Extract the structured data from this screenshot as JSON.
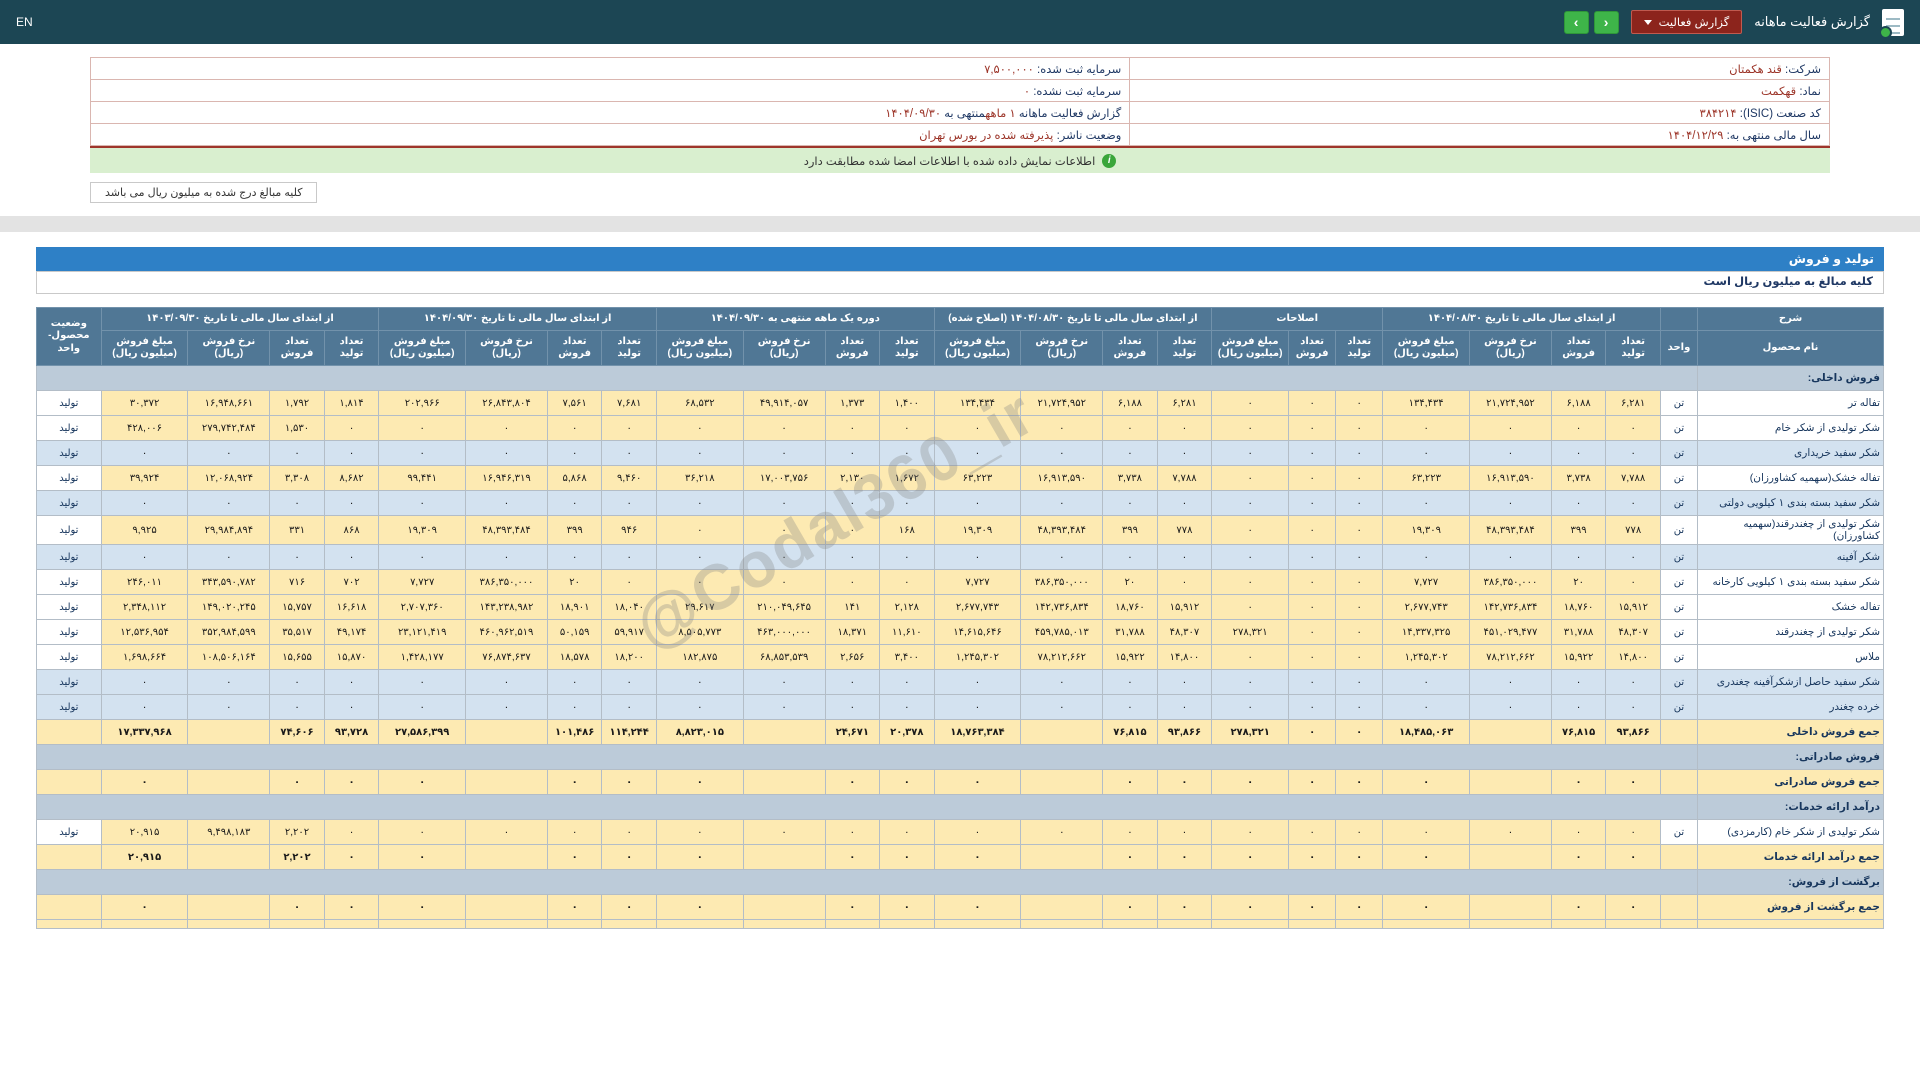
{
  "colors": {
    "topbar_bg": "#1c4654",
    "accent_red": "#8c241c",
    "accent_green": "#3eb449",
    "banner_blue": "#2e80c6",
    "table_header_blue": "#507795",
    "cell_yellow": "#fdeab2",
    "cell_blue": "#d3e2f0",
    "section_gray": "#bccbd9",
    "value_maroon": "#9c3428",
    "label_navy": "#1f3864",
    "notice_green": "#d9efcf"
  },
  "topbar": {
    "title": "گزارش فعالیت ماهانه",
    "report_button": "گزارش فعالیت",
    "prev": "‹",
    "next": "›",
    "lang": "EN"
  },
  "header_info": {
    "rows": [
      {
        "right_label": "شرکت:",
        "right_value": "قند هکمتان",
        "left_label": "سرمایه ثبت شده:",
        "left_value": "۷,۵۰۰,۰۰۰"
      },
      {
        "right_label": "نماد:",
        "right_value": "قهکمت",
        "left_label": "سرمایه ثبت نشده:",
        "left_value": "۰"
      },
      {
        "right_label": "کد صنعت (ISIC):",
        "right_value": "۳۸۴۲۱۴",
        "left_label": "گزارش فعالیت ماهانه",
        "left_value": "۱ ماهه",
        "left_label2": "منتهی به",
        "left_value2": "۱۴۰۴/۰۹/۳۰"
      },
      {
        "right_label": "سال مالی منتهی به:",
        "right_value": "۱۴۰۴/۱۲/۲۹",
        "left_label": "وضعیت ناشر:",
        "left_value": "پذیرفته شده در بورس تهران"
      }
    ]
  },
  "notice": {
    "text": "اطلاعات نمایش داده شده با اطلاعات امضا شده مطابقت دارد"
  },
  "amounts_note_box": "کلیه مبالغ درج شده به میلیون ریال می باشد",
  "section_banner": "تولید و فروش",
  "amounts_note_row": "کلیه مبالغ به میلیون ریال است",
  "watermark": "@Codal360_ir",
  "table": {
    "col_headers": {
      "desc": "شرح",
      "product": "نام محصول",
      "unit": "واحد",
      "status": "وضعیت محصول-واحد",
      "groups": [
        {
          "title": "از ابتدای سال مالی تا تاریخ ۱۴۰۴/۰۸/۳۰",
          "cols": [
            "تعداد تولید",
            "تعداد فروش",
            "نرخ فروش (ریال)",
            "مبلغ فروش (میلیون ریال)"
          ]
        },
        {
          "title": "اصلاحات",
          "cols": [
            "تعداد تولید",
            "تعداد فروش",
            "مبلغ فروش (میلیون ریال)"
          ]
        },
        {
          "title": "از ابتدای سال مالی تا تاریخ ۱۴۰۴/۰۸/۳۰ (اصلاح شده)",
          "cols": [
            "تعداد تولید",
            "تعداد فروش",
            "نرخ فروش (ریال)",
            "مبلغ فروش (میلیون ریال)"
          ]
        },
        {
          "title": "دوره یک ماهه منتهی به ۱۴۰۴/۰۹/۳۰",
          "cols": [
            "تعداد تولید",
            "تعداد فروش",
            "نرخ فروش (ریال)",
            "مبلغ فروش (میلیون ریال)"
          ]
        },
        {
          "title": "از ابتدای سال مالی تا تاریخ ۱۴۰۴/۰۹/۳۰",
          "cols": [
            "تعداد تولید",
            "تعداد فروش",
            "نرخ فروش (ریال)",
            "مبلغ فروش (میلیون ریال)"
          ]
        },
        {
          "title": "از ابتدای سال مالی تا تاریخ ۱۴۰۳/۰۹/۳۰",
          "cols": [
            "تعداد تولید",
            "تعداد فروش",
            "نرخ فروش (ریال)",
            "مبلغ فروش (میلیون ریال)"
          ]
        }
      ]
    },
    "rows": [
      {
        "type": "section",
        "name": "فروش داخلی:"
      },
      {
        "type": "product",
        "zero": false,
        "name": "تفاله تر",
        "unit": "تن",
        "status": "تولید",
        "cells": [
          "۶,۲۸۱",
          "۶,۱۸۸",
          "۲۱,۷۲۴,۹۵۲",
          "۱۳۴,۴۳۴",
          "۰",
          "۰",
          "۰",
          "۶,۲۸۱",
          "۶,۱۸۸",
          "۲۱,۷۲۴,۹۵۲",
          "۱۳۴,۴۳۴",
          "۱,۴۰۰",
          "۱,۳۷۳",
          "۴۹,۹۱۴,۰۵۷",
          "۶۸,۵۳۲",
          "۷,۶۸۱",
          "۷,۵۶۱",
          "۲۶,۸۴۳,۸۰۴",
          "۲۰۲,۹۶۶",
          "۱,۸۱۴",
          "۱,۷۹۲",
          "۱۶,۹۴۸,۶۶۱",
          "۳۰,۳۷۲"
        ]
      },
      {
        "type": "product",
        "zero": false,
        "name": "شکر تولیدی از شکر خام",
        "unit": "تن",
        "status": "تولید",
        "cells": [
          "۰",
          "۰",
          "۰",
          "۰",
          "۰",
          "۰",
          "۰",
          "۰",
          "۰",
          "۰",
          "۰",
          "۰",
          "۰",
          "۰",
          "۰",
          "۰",
          "۰",
          "۰",
          "۰",
          "۰",
          "۱,۵۳۰",
          "۲۷۹,۷۴۲,۴۸۴",
          "۴۲۸,۰۰۶"
        ]
      },
      {
        "type": "product",
        "zero": true,
        "name": "شکر سفید خریداری",
        "unit": "تن",
        "status": "تولید",
        "cells": [
          "۰",
          "۰",
          "۰",
          "۰",
          "۰",
          "۰",
          "۰",
          "۰",
          "۰",
          "۰",
          "۰",
          "۰",
          "۰",
          "۰",
          "۰",
          "۰",
          "۰",
          "۰",
          "۰",
          "۰",
          "۰",
          "۰",
          "۰"
        ]
      },
      {
        "type": "product",
        "zero": false,
        "name": "تفاله خشک(سهمیه کشاورزان)",
        "unit": "تن",
        "status": "تولید",
        "cells": [
          "۷,۷۸۸",
          "۳,۷۳۸",
          "۱۶,۹۱۳,۵۹۰",
          "۶۳,۲۲۳",
          "۰",
          "۰",
          "۰",
          "۷,۷۸۸",
          "۳,۷۳۸",
          "۱۶,۹۱۳,۵۹۰",
          "۶۳,۲۲۳",
          "۱,۶۷۲",
          "۲,۱۳۰",
          "۱۷,۰۰۳,۷۵۶",
          "۳۶,۲۱۸",
          "۹,۴۶۰",
          "۵,۸۶۸",
          "۱۶,۹۴۶,۳۱۹",
          "۹۹,۴۴۱",
          "۸,۶۸۲",
          "۳,۳۰۸",
          "۱۲,۰۶۸,۹۲۴",
          "۳۹,۹۲۴"
        ]
      },
      {
        "type": "product",
        "zero": true,
        "name": "شکر سفید بسته بندی ۱ کیلویی دولتی",
        "unit": "تن",
        "status": "تولید",
        "cells": [
          "۰",
          "۰",
          "۰",
          "۰",
          "۰",
          "۰",
          "۰",
          "۰",
          "۰",
          "۰",
          "۰",
          "۰",
          "۰",
          "۰",
          "۰",
          "۰",
          "۰",
          "۰",
          "۰",
          "۰",
          "۰",
          "۰",
          "۰"
        ]
      },
      {
        "type": "product",
        "zero": false,
        "name": "شکر تولیدی از چغندرقند(سهمیه کشاورزان)",
        "unit": "تن",
        "status": "تولید",
        "cells": [
          "۷۷۸",
          "۳۹۹",
          "۴۸,۳۹۳,۴۸۴",
          "۱۹,۳۰۹",
          "۰",
          "۰",
          "۰",
          "۷۷۸",
          "۳۹۹",
          "۴۸,۳۹۳,۴۸۴",
          "۱۹,۳۰۹",
          "۱۶۸",
          "۰",
          "۰",
          "۰",
          "۹۴۶",
          "۳۹۹",
          "۴۸,۳۹۳,۴۸۴",
          "۱۹,۳۰۹",
          "۸۶۸",
          "۳۳۱",
          "۲۹,۹۸۴,۸۹۴",
          "۹,۹۲۵"
        ]
      },
      {
        "type": "product",
        "zero": true,
        "name": "شکر آفینه",
        "unit": "تن",
        "status": "تولید",
        "cells": [
          "۰",
          "۰",
          "۰",
          "۰",
          "۰",
          "۰",
          "۰",
          "۰",
          "۰",
          "۰",
          "۰",
          "۰",
          "۰",
          "۰",
          "۰",
          "۰",
          "۰",
          "۰",
          "۰",
          "۰",
          "۰",
          "۰",
          "۰"
        ]
      },
      {
        "type": "product",
        "zero": false,
        "name": "شکر سفید بسته بندی ۱ کیلویی کارخانه",
        "unit": "تن",
        "status": "تولید",
        "cells": [
          "۰",
          "۲۰",
          "۳۸۶,۳۵۰,۰۰۰",
          "۷,۷۲۷",
          "۰",
          "۰",
          "۰",
          "۰",
          "۲۰",
          "۳۸۶,۳۵۰,۰۰۰",
          "۷,۷۲۷",
          "۰",
          "۰",
          "۰",
          "۰",
          "۰",
          "۲۰",
          "۳۸۶,۳۵۰,۰۰۰",
          "۷,۷۲۷",
          "۷۰۲",
          "۷۱۶",
          "۳۴۳,۵۹۰,۷۸۲",
          "۲۴۶,۰۱۱"
        ]
      },
      {
        "type": "product",
        "zero": false,
        "name": "تفاله خشک",
        "unit": "تن",
        "status": "تولید",
        "cells": [
          "۱۵,۹۱۲",
          "۱۸,۷۶۰",
          "۱۴۲,۷۳۶,۸۳۴",
          "۲,۶۷۷,۷۴۳",
          "۰",
          "۰",
          "۰",
          "۱۵,۹۱۲",
          "۱۸,۷۶۰",
          "۱۴۲,۷۳۶,۸۳۴",
          "۲,۶۷۷,۷۴۳",
          "۲,۱۲۸",
          "۱۴۱",
          "۲۱۰,۰۴۹,۶۴۵",
          "۲۹,۶۱۷",
          "۱۸,۰۴۰",
          "۱۸,۹۰۱",
          "۱۴۳,۲۳۸,۹۸۲",
          "۲,۷۰۷,۳۶۰",
          "۱۶,۶۱۸",
          "۱۵,۷۵۷",
          "۱۴۹,۰۲۰,۲۴۵",
          "۲,۳۴۸,۱۱۲"
        ]
      },
      {
        "type": "product",
        "zero": false,
        "name": "شکر تولیدی از چغندرقند",
        "unit": "تن",
        "status": "تولید",
        "cells": [
          "۴۸,۳۰۷",
          "۳۱,۷۸۸",
          "۴۵۱,۰۲۹,۴۷۷",
          "۱۴,۳۳۷,۳۲۵",
          "۰",
          "۰",
          "۲۷۸,۳۲۱",
          "۴۸,۳۰۷",
          "۳۱,۷۸۸",
          "۴۵۹,۷۸۵,۰۱۳",
          "۱۴,۶۱۵,۶۴۶",
          "۱۱,۶۱۰",
          "۱۸,۳۷۱",
          "۴۶۳,۰۰۰,۰۰۰",
          "۸,۵۰۵,۷۷۳",
          "۵۹,۹۱۷",
          "۵۰,۱۵۹",
          "۴۶۰,۹۶۲,۵۱۹",
          "۲۳,۱۲۱,۴۱۹",
          "۴۹,۱۷۴",
          "۳۵,۵۱۷",
          "۳۵۲,۹۸۴,۵۹۹",
          "۱۲,۵۳۶,۹۵۴"
        ]
      },
      {
        "type": "product",
        "zero": false,
        "name": "ملاس",
        "unit": "تن",
        "status": "تولید",
        "cells": [
          "۱۴,۸۰۰",
          "۱۵,۹۲۲",
          "۷۸,۲۱۲,۶۶۲",
          "۱,۲۴۵,۳۰۲",
          "۰",
          "۰",
          "۰",
          "۱۴,۸۰۰",
          "۱۵,۹۲۲",
          "۷۸,۲۱۲,۶۶۲",
          "۱,۲۴۵,۳۰۲",
          "۳,۴۰۰",
          "۲,۶۵۶",
          "۶۸,۸۵۳,۵۳۹",
          "۱۸۲,۸۷۵",
          "۱۸,۲۰۰",
          "۱۸,۵۷۸",
          "۷۶,۸۷۴,۶۳۷",
          "۱,۴۲۸,۱۷۷",
          "۱۵,۸۷۰",
          "۱۵,۶۵۵",
          "۱۰۸,۵۰۶,۱۶۴",
          "۱,۶۹۸,۶۶۴"
        ]
      },
      {
        "type": "product",
        "zero": true,
        "name": "شکر سفید حاصل ازشکرآفینه چغندری",
        "unit": "تن",
        "status": "تولید",
        "cells": [
          "۰",
          "۰",
          "۰",
          "۰",
          "۰",
          "۰",
          "۰",
          "۰",
          "۰",
          "۰",
          "۰",
          "۰",
          "۰",
          "۰",
          "۰",
          "۰",
          "۰",
          "۰",
          "۰",
          "۰",
          "۰",
          "۰",
          "۰"
        ]
      },
      {
        "type": "product",
        "zero": true,
        "name": "خرده چغندر",
        "unit": "تن",
        "status": "تولید",
        "cells": [
          "۰",
          "۰",
          "۰",
          "۰",
          "۰",
          "۰",
          "۰",
          "۰",
          "۰",
          "۰",
          "۰",
          "۰",
          "۰",
          "۰",
          "۰",
          "۰",
          "۰",
          "۰",
          "۰",
          "۰",
          "۰",
          "۰",
          "۰"
        ]
      },
      {
        "type": "total",
        "name": "جمع فروش داخلی",
        "cells": [
          "۹۳,۸۶۶",
          "۷۶,۸۱۵",
          "",
          "۱۸,۴۸۵,۰۶۳",
          "۰",
          "۰",
          "۲۷۸,۳۲۱",
          "۹۳,۸۶۶",
          "۷۶,۸۱۵",
          "",
          "۱۸,۷۶۳,۳۸۴",
          "۲۰,۳۷۸",
          "۲۴,۶۷۱",
          "",
          "۸,۸۲۳,۰۱۵",
          "۱۱۴,۲۴۴",
          "۱۰۱,۴۸۶",
          "",
          "۲۷,۵۸۶,۳۹۹",
          "۹۳,۷۲۸",
          "۷۴,۶۰۶",
          "",
          "۱۷,۳۳۷,۹۶۸"
        ]
      },
      {
        "type": "section",
        "name": "فروش صادراتی:"
      },
      {
        "type": "total",
        "name": "جمع فروش صادراتی",
        "cells": [
          "۰",
          "۰",
          "",
          "۰",
          "۰",
          "۰",
          "۰",
          "۰",
          "۰",
          "",
          "۰",
          "۰",
          "۰",
          "",
          "۰",
          "۰",
          "۰",
          "",
          "۰",
          "۰",
          "۰",
          "",
          "۰"
        ]
      },
      {
        "type": "section",
        "name": "درآمد ارائه خدمات:"
      },
      {
        "type": "product",
        "zero": false,
        "name": "شکر تولیدی از شکر خام (کارمزدی)",
        "unit": "تن",
        "status": "تولید",
        "cells": [
          "۰",
          "۰",
          "۰",
          "۰",
          "۰",
          "۰",
          "۰",
          "۰",
          "۰",
          "۰",
          "۰",
          "۰",
          "۰",
          "۰",
          "۰",
          "۰",
          "۰",
          "۰",
          "۰",
          "۰",
          "۲,۲۰۲",
          "۹,۴۹۸,۱۸۳",
          "۲۰,۹۱۵"
        ]
      },
      {
        "type": "total",
        "name": "جمع درآمد ارائه خدمات",
        "cells": [
          "۰",
          "۰",
          "",
          "۰",
          "۰",
          "۰",
          "۰",
          "۰",
          "۰",
          "",
          "۰",
          "۰",
          "۰",
          "",
          "۰",
          "۰",
          "۰",
          "",
          "۰",
          "۰",
          "۲,۲۰۲",
          "",
          "۲۰,۹۱۵"
        ]
      },
      {
        "type": "section",
        "name": "برگشت از فروش:"
      },
      {
        "type": "total",
        "name": "جمع برگشت از فروش",
        "cells": [
          "۰",
          "۰",
          "",
          "۰",
          "۰",
          "۰",
          "۰",
          "۰",
          "۰",
          "",
          "۰",
          "۰",
          "۰",
          "",
          "۰",
          "۰",
          "۰",
          "",
          "۰",
          "۰",
          "۰",
          "",
          "۰"
        ]
      },
      {
        "type": "partial"
      }
    ]
  }
}
